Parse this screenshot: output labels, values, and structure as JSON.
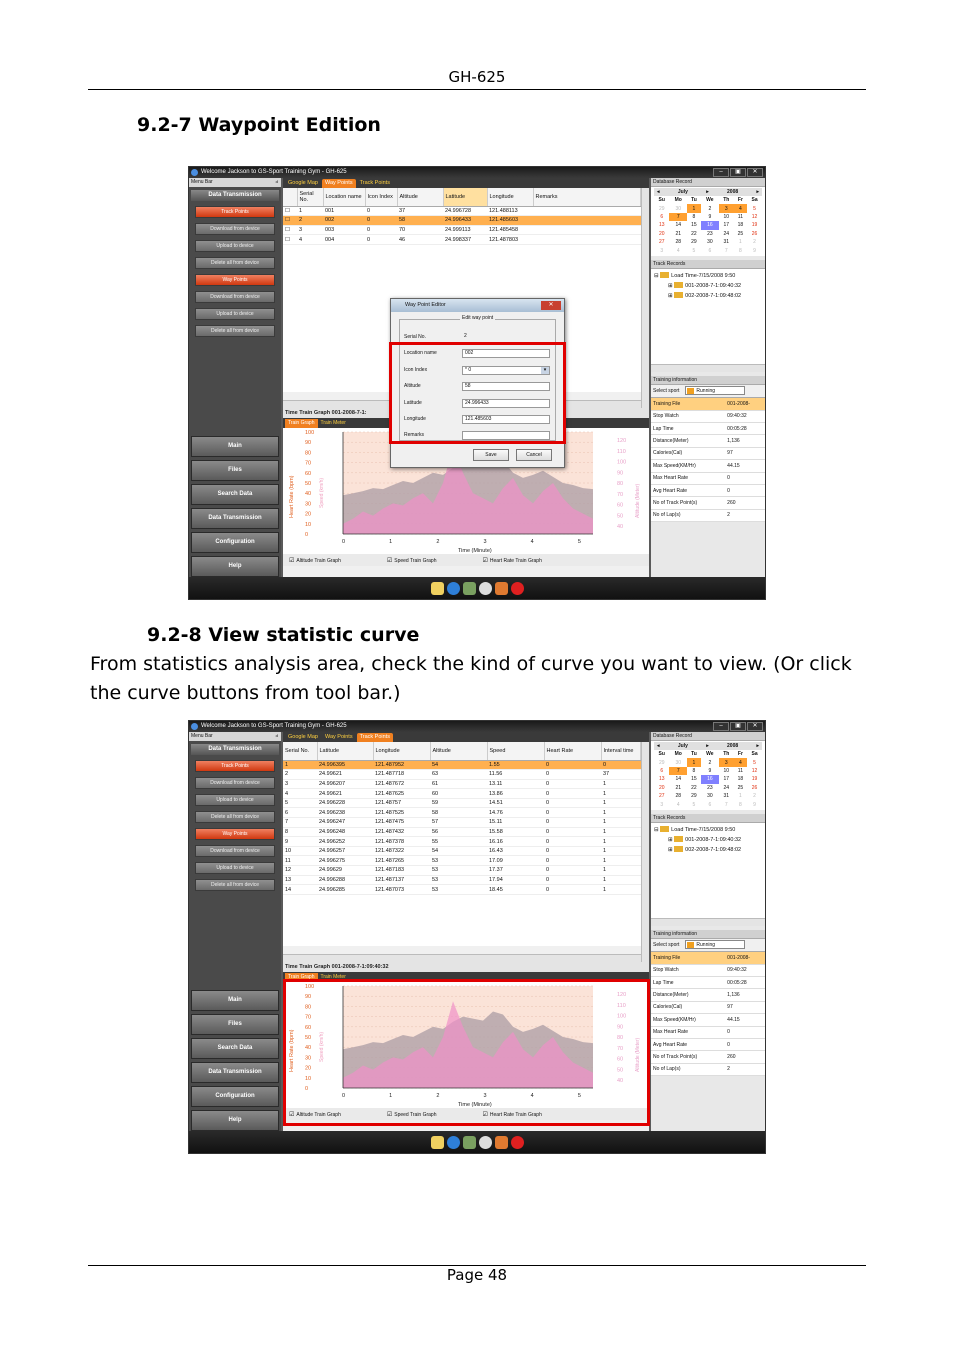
{
  "header": {
    "product": "GH-625"
  },
  "section1": {
    "heading": "9.2-7 Waypoint Edition"
  },
  "section2": {
    "heading": "9.2-8 View statistic curve",
    "para_line1": "From statistics analysis area, check the kind of curve you want to view. (Or click",
    "para_line2": "the curve buttons from tool bar.)"
  },
  "footer": {
    "page": "Page 48"
  },
  "app": {
    "window_title": "Welcome Jackson to GS-Sport Training Gym - GH-625",
    "menu_bar": "Menu Bar",
    "left_title": "Data Transmission",
    "left_buttons": [
      "Track Points",
      "Download from device",
      "Upload to device",
      "Delete all from device",
      "Way Points",
      "Download from device",
      "Upload to device",
      "Delete all from device"
    ],
    "big_buttons": [
      "Main",
      "Files",
      "Search Data",
      "Data Transmission",
      "Configuration",
      "Help"
    ],
    "tabs": [
      "Google Map",
      "Way Points",
      "Track Points"
    ],
    "graph_tabs": [
      "Train Graph",
      "Train Meter"
    ],
    "checks": [
      "Altitude Train Graph",
      "Speed Train Graph",
      "Heart Rate Train Graph"
    ],
    "database_record": "Database Record",
    "cal": {
      "month": "July",
      "year": "2008",
      "days": [
        "Su",
        "Mo",
        "Tu",
        "We",
        "Th",
        "Fr",
        "Sa"
      ],
      "weeks": [
        [
          "29",
          "30",
          "1",
          "2",
          "3",
          "4",
          "5"
        ],
        [
          "6",
          "7",
          "8",
          "9",
          "10",
          "11",
          "12"
        ],
        [
          "13",
          "14",
          "15",
          "16",
          "17",
          "18",
          "19"
        ],
        [
          "20",
          "21",
          "22",
          "23",
          "24",
          "25",
          "26"
        ],
        [
          "27",
          "28",
          "29",
          "30",
          "31",
          "1",
          "2"
        ],
        [
          "3",
          "4",
          "5",
          "6",
          "7",
          "8",
          "9"
        ]
      ]
    },
    "track_records": "Track Records",
    "tree": [
      "Load Time-7/15/2008 9:50",
      "001-2008-7-1:09:40:32",
      "002-2008-7-1:09:48:02"
    ],
    "training_information": "Training information",
    "select_sport": "Select sport",
    "sport": "Running",
    "info_rows": [
      [
        "Training File",
        "001-2008-"
      ],
      [
        "Stop Watch",
        "09:40:32"
      ],
      [
        "Lap Time",
        "00:05:28"
      ],
      [
        "Distance(Meter)",
        "1,136"
      ],
      [
        "Calories(Cal)",
        "97"
      ],
      [
        "Max Speed(KM/Hr)",
        "44.15"
      ],
      [
        "Max Heart Rate",
        "0"
      ],
      [
        "Avg Heart Rate",
        "0"
      ],
      [
        "No of Track Point(s)",
        "260"
      ],
      [
        "No of Lap(s)",
        "2"
      ]
    ],
    "graph_yleft": [
      "100",
      "90",
      "80",
      "70",
      "60",
      "50",
      "40",
      "30",
      "20",
      "10",
      "0"
    ],
    "graph_yright": [
      "120",
      "110",
      "100",
      "90",
      "80",
      "70",
      "60",
      "50",
      "40"
    ],
    "graph_x": [
      "0",
      "1",
      "2",
      "3",
      "4",
      "5"
    ],
    "graph_xlabel": "Time (Minute)",
    "graph_ylabel_left": "Heart Rate (bpm)",
    "graph_ylabel_speed": "Speed (km/h)",
    "graph_ylabel_right": "Altitude (Meter)"
  },
  "shot1": {
    "columns": [
      "Serial No.",
      "Location name",
      "Icon Index",
      "Altitude",
      "Latitude",
      "Longitude",
      "Remarks"
    ],
    "rows": [
      [
        "1",
        "001",
        "0",
        "37",
        "24.996728",
        "121.488113",
        ""
      ],
      [
        "2",
        "002",
        "0",
        "58",
        "24.996433",
        "121.485603",
        ""
      ],
      [
        "3",
        "003",
        "0",
        "70",
        "24.999113",
        "121.485458",
        ""
      ],
      [
        "4",
        "004",
        "0",
        "46",
        "24.998337",
        "121.487803",
        ""
      ]
    ],
    "graph_title": "Time Train Graph 001-2008-7-1:",
    "dialog": {
      "title": "Way Point Editor",
      "group": "Edit way point",
      "fields": [
        [
          "Serial No.",
          "2"
        ],
        [
          "Location name",
          "002"
        ],
        [
          "Icon Index",
          "0"
        ],
        [
          "Altitude",
          "58"
        ],
        [
          "Latitude",
          "24.996433"
        ],
        [
          "Longitude",
          "121.485603"
        ],
        [
          "Remarks",
          ""
        ]
      ],
      "save": "Save",
      "cancel": "Cancel"
    }
  },
  "shot2": {
    "columns": [
      "Serial No.",
      "Latitude",
      "Longitude",
      "Altitude",
      "Speed",
      "Heart Rate",
      "Interval time"
    ],
    "rows": [
      [
        "1",
        "24.996395",
        "121.487952",
        "54",
        "1.55",
        "0",
        "0"
      ],
      [
        "2",
        "24.99621",
        "121.487718",
        "63",
        "11.56",
        "0",
        "37"
      ],
      [
        "3",
        "24.996207",
        "121.487672",
        "61",
        "13.11",
        "0",
        "1"
      ],
      [
        "4",
        "24.99621",
        "121.487625",
        "60",
        "13.86",
        "0",
        "1"
      ],
      [
        "5",
        "24.996228",
        "121.48757",
        "59",
        "14.51",
        "0",
        "1"
      ],
      [
        "6",
        "24.996238",
        "121.487525",
        "58",
        "14.76",
        "0",
        "1"
      ],
      [
        "7",
        "24.996247",
        "121.487475",
        "57",
        "15.11",
        "0",
        "1"
      ],
      [
        "8",
        "24.996248",
        "121.487432",
        "56",
        "15.58",
        "0",
        "1"
      ],
      [
        "9",
        "24.996252",
        "121.487378",
        "55",
        "16.16",
        "0",
        "1"
      ],
      [
        "10",
        "24.996257",
        "121.487322",
        "54",
        "16.43",
        "0",
        "1"
      ],
      [
        "11",
        "24.996275",
        "121.487265",
        "53",
        "17.09",
        "0",
        "1"
      ],
      [
        "12",
        "24.99629",
        "121.487183",
        "53",
        "17.37",
        "0",
        "1"
      ],
      [
        "13",
        "24.996288",
        "121.487137",
        "53",
        "17.94",
        "0",
        "1"
      ],
      [
        "14",
        "24.996285",
        "121.487073",
        "53",
        "18.45",
        "0",
        "1"
      ]
    ],
    "graph_title": "Time Train Graph 001-2008-7-1:09:40:32"
  },
  "colors": {
    "accent": "#f08020",
    "highlight": "#e00000"
  },
  "statusbar_icons": [
    "new-file-icon",
    "globe-icon",
    "map-icon",
    "disc-icon",
    "people-icon",
    "close-red-icon"
  ]
}
